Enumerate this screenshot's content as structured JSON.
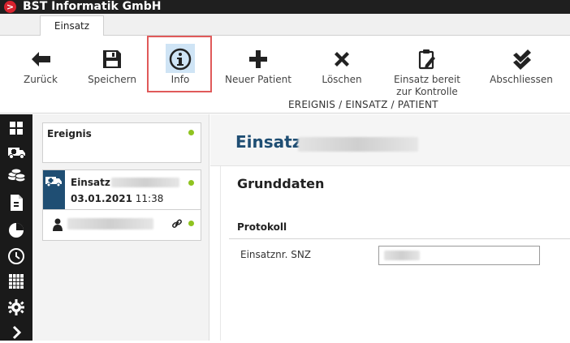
{
  "app": {
    "title": "BST Informatik GmbH",
    "logo_glyph": ">"
  },
  "tabs": [
    {
      "label": "Einsatz"
    }
  ],
  "ribbon": {
    "buttons": [
      {
        "label": "Zurück",
        "icon": "arrow-left-icon"
      },
      {
        "label": "Speichern",
        "icon": "floppy-icon"
      },
      {
        "label": "Info",
        "icon": "info-icon"
      },
      {
        "label": "Neuer Patient",
        "icon": "plus-icon"
      },
      {
        "label": "Löschen",
        "icon": "x-icon"
      },
      {
        "label_line1": "Einsatz bereit",
        "label_line2": "zur Kontrolle",
        "icon": "clipboard-edit-icon"
      },
      {
        "label": "Abschliessen",
        "icon": "double-check-icon"
      }
    ],
    "breadcrumb": "EREIGNIS / EINSATZ / PATIENT"
  },
  "sidebar": {
    "icons": [
      "dashboard-icon",
      "ambulance-icon",
      "coins-icon",
      "document-icon",
      "pie-chart-icon",
      "clock-icon",
      "calendar-icon",
      "gear-icon",
      "chevron-right-icon"
    ]
  },
  "left_panel": {
    "ereignis_label": "Ereignis",
    "einsatz_label": "Einsatz",
    "einsatz_date": "03.01.2021",
    "einsatz_time": "11:38"
  },
  "main": {
    "title": "Einsatz",
    "section_title": "Grunddaten",
    "protokoll_label": "Protokoll",
    "field_label": "Einsatznr. SNZ"
  },
  "colors": {
    "accent": "#1f4e73",
    "status_dot": "#8fc31f",
    "highlight": "#e05a5a",
    "titlebar": "#1f1f1f"
  }
}
